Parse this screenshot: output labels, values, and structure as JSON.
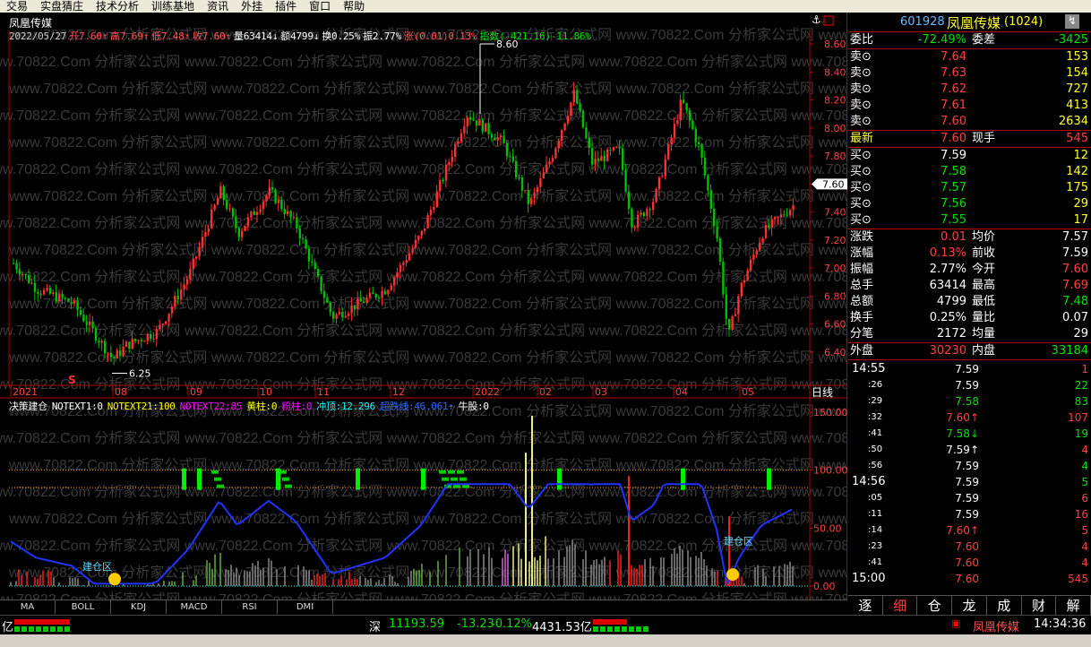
{
  "menu": [
    "交易",
    "实盘猜庄",
    "技术分析",
    "训练基地",
    "资讯",
    "外挂",
    "插件",
    "窗口",
    "帮助"
  ],
  "chart": {
    "tab_title": "凤凰传媒",
    "period": "日线",
    "info": [
      {
        "t": "2022/05/27",
        "c": "#cccccc"
      },
      {
        "t": "开7.60↑",
        "c": "#ff5050"
      },
      {
        "t": "高7.69↑",
        "c": "#ff5050"
      },
      {
        "t": "低7.48↑",
        "c": "#ff5050"
      },
      {
        "t": "收7.60↑",
        "c": "#ff5050"
      },
      {
        "t": "量63414↓",
        "c": "#ffffff"
      },
      {
        "t": "额4799↓",
        "c": "#ffffff"
      },
      {
        "t": "换0.25%",
        "c": "#ffffff"
      },
      {
        "t": "振2.77%",
        "c": "#ffffff"
      },
      {
        "t": "涨(0.01)0.13%",
        "c": "#ff5050"
      },
      {
        "t": "指数(-421.16)-11.86%",
        "c": "#00e000"
      }
    ],
    "price_axis": [
      "8.60",
      "8.40",
      "8.20",
      "8.00",
      "7.80",
      "7.60",
      "7.40",
      "7.20",
      "7.00",
      "6.80",
      "6.60",
      "6.40"
    ],
    "current_price": "7.60",
    "high_label": "8.60",
    "low_label": "6.25",
    "date_axis": [
      "2021",
      "08",
      "09",
      "10",
      "11",
      "12",
      "2022",
      "02",
      "03",
      "04",
      "05"
    ],
    "indicator_axis": [
      "150.00",
      "100.00",
      "50.00",
      "0.00"
    ],
    "indicator_line": [
      {
        "t": "决策建仓",
        "c": "#ffffff"
      },
      {
        "t": "NOTEXT1:0",
        "c": "#ffffff"
      },
      {
        "t": "NOTEXT21:100",
        "c": "#ffff00"
      },
      {
        "t": "NOTEXT22:85",
        "c": "#ff00ff"
      },
      {
        "t": "黄柱:0",
        "c": "#ffff00"
      },
      {
        "t": "粉柱:0",
        "c": "#ff00ff"
      },
      {
        "t": "冲顶:12.296",
        "c": "#00ffff"
      },
      {
        "t": "超跌线:46.061↑",
        "c": "#3366ff"
      },
      {
        "t": "牛股:0",
        "c": "#ffffff"
      }
    ],
    "zone_label": "建仓区",
    "watermark": "www.70822.Com 分析家公式网"
  },
  "bottom_tabs": [
    "MA",
    "BOLL",
    "KDJ",
    "MACD",
    "RSI",
    "DMI"
  ],
  "status": {
    "left_unit": "亿",
    "market": "深",
    "index_value": "11193.59",
    "change": "-13.23",
    "pct": "-0.12%",
    "amount": "4431.53亿",
    "stock_tag": "凤凰传媒",
    "clock": "14:34:36"
  },
  "quote": {
    "code": "601928",
    "name": "凤凰传媒",
    "board": "(1024)",
    "weibi_label": "委比",
    "weibi": "-72.49%",
    "weicha_label": "委差",
    "weicha": "-3425",
    "asks": [
      {
        "l": "卖⊙",
        "p": "7.64",
        "v": "153"
      },
      {
        "l": "卖⊙",
        "p": "7.63",
        "v": "154"
      },
      {
        "l": "卖⊙",
        "p": "7.62",
        "v": "727"
      },
      {
        "l": "卖⊙",
        "p": "7.61",
        "v": "413"
      },
      {
        "l": "卖⊙",
        "p": "7.60",
        "v": "2634"
      }
    ],
    "latest_label": "最新",
    "latest": "7.60",
    "xianshou_label": "现手",
    "xianshou": "545",
    "bids": [
      {
        "l": "买⊙",
        "p": "7.59",
        "v": "12"
      },
      {
        "l": "买⊙",
        "p": "7.58",
        "v": "142"
      },
      {
        "l": "买⊙",
        "p": "7.57",
        "v": "175"
      },
      {
        "l": "买⊙",
        "p": "7.56",
        "v": "29"
      },
      {
        "l": "买⊙",
        "p": "7.55",
        "v": "17"
      }
    ],
    "stats": [
      {
        "a": "涨跌",
        "av": "0.01",
        "ac": "#ff4040",
        "b": "均价",
        "bv": "7.57",
        "bc": "#ffffff"
      },
      {
        "a": "涨幅",
        "av": "0.13%",
        "ac": "#ff4040",
        "b": "前收",
        "bv": "7.59",
        "bc": "#ffffff"
      },
      {
        "a": "振幅",
        "av": "2.77%",
        "ac": "#ffffff",
        "b": "今开",
        "bv": "7.60",
        "bc": "#ff4040"
      },
      {
        "a": "总手",
        "av": "63414",
        "ac": "#ffffff",
        "b": "最高",
        "bv": "7.69",
        "bc": "#ff4040"
      },
      {
        "a": "总额",
        "av": "4799",
        "ac": "#ffffff",
        "b": "最低",
        "bv": "7.48",
        "bc": "#00e000"
      },
      {
        "a": "换手",
        "av": "0.25%",
        "ac": "#ffffff",
        "b": "量比",
        "bv": "0.07",
        "bc": "#ffffff"
      },
      {
        "a": "分笔",
        "av": "2172",
        "ac": "#ffffff",
        "b": "均量",
        "bv": "29",
        "bc": "#ffffff"
      }
    ],
    "waipan_label": "外盘",
    "waipan": "30230",
    "neipan_label": "内盘",
    "neipan": "33184",
    "ticks": [
      {
        "t": "14:55",
        "p": "7.59",
        "pc": "#ffffff",
        "v": "1",
        "vc": "#ff4040",
        "big": true
      },
      {
        "t": ":26",
        "p": "7.59",
        "pc": "#ffffff",
        "v": "22",
        "vc": "#00e000"
      },
      {
        "t": ":29",
        "p": "7.58",
        "pc": "#00e000",
        "v": "83",
        "vc": "#00e000"
      },
      {
        "t": ":32",
        "p": "7.60↑",
        "pc": "#ff4040",
        "v": "107",
        "vc": "#ff4040"
      },
      {
        "t": ":41",
        "p": "7.58↓",
        "pc": "#00e000",
        "v": "19",
        "vc": "#00e000"
      },
      {
        "t": ":50",
        "p": "7.59↑",
        "pc": "#ffffff",
        "v": "4",
        "vc": "#ff4040"
      },
      {
        "t": ":56",
        "p": "7.59",
        "pc": "#ffffff",
        "v": "4",
        "vc": "#00e000"
      },
      {
        "t": "14:56",
        "p": "7.59",
        "pc": "#ffffff",
        "v": "5",
        "vc": "#00e000",
        "big": true
      },
      {
        "t": ":05",
        "p": "7.59",
        "pc": "#ffffff",
        "v": "6",
        "vc": "#ff4040"
      },
      {
        "t": ":11",
        "p": "7.59",
        "pc": "#ffffff",
        "v": "16",
        "vc": "#ff4040"
      },
      {
        "t": ":14",
        "p": "7.60↑",
        "pc": "#ff4040",
        "v": "5",
        "vc": "#ff4040"
      },
      {
        "t": ":23",
        "p": "7.60",
        "pc": "#ff4040",
        "v": "4",
        "vc": "#ff4040"
      },
      {
        "t": ":41",
        "p": "7.60",
        "pc": "#ff4040",
        "v": "4",
        "vc": "#ff4040"
      },
      {
        "t": "15:00",
        "p": "7.60",
        "pc": "#ff4040",
        "v": "545",
        "vc": "#ff4040",
        "big": true
      }
    ],
    "bottom_tabs": [
      "逐",
      "细",
      "仓",
      "龙",
      "成",
      "财",
      "解"
    ]
  },
  "colors": {
    "up": "#ff3030",
    "down": "#00c000",
    "grid": "#b00000",
    "axis": "#b00000",
    "line": "#2233ff"
  }
}
